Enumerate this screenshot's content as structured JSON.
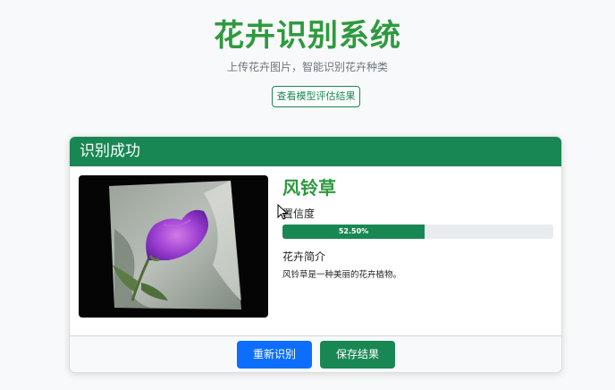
{
  "header": {
    "title": "花卉识别系统",
    "subtitle": "上传花卉图片，智能识别花卉种类",
    "eval_button": "查看模型评估结果"
  },
  "result": {
    "header": "识别成功",
    "flower_name": "风铃草",
    "confidence_label": "置信度",
    "confidence_text": "52.50%",
    "confidence_value": 52.5,
    "intro_label": "花卉简介",
    "intro_text": "风铃草是一种美丽的花卉植物。"
  },
  "actions": {
    "retry_button": "重新识别",
    "save_button": "保存结果"
  },
  "colors": {
    "accent_green": "#198754",
    "title_green": "#2e9a3e",
    "primary_blue": "#0d6efd"
  }
}
